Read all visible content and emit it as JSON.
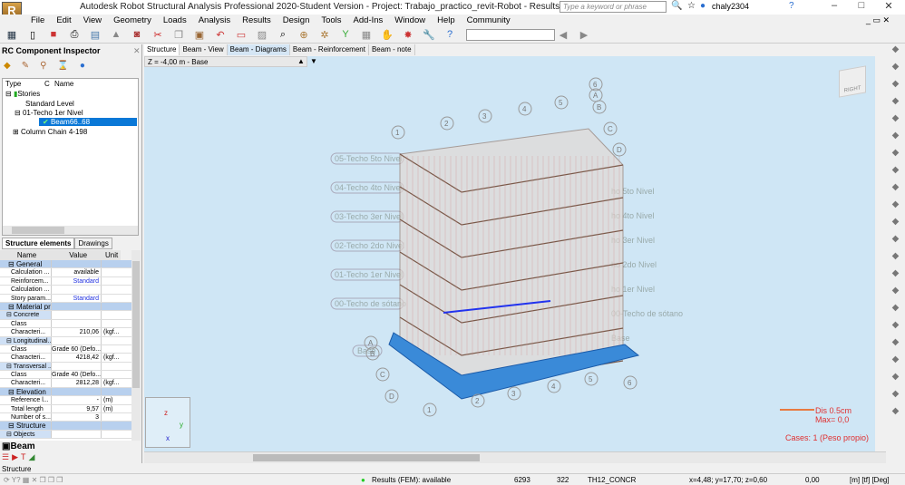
{
  "app": {
    "title": "Autodesk Robot Structural Analysis Professional 2020-Student Version - Project: Trabajo_practico_revit-Robot - Results (FEM): available",
    "logo": "R PRO",
    "search_placeholder": "Type a keyword or phrase",
    "user": "chaly2304"
  },
  "menu": [
    "File",
    "Edit",
    "View",
    "Geometry",
    "Loads",
    "Analysis",
    "Results",
    "Design",
    "Tools",
    "Add-Ins",
    "Window",
    "Help",
    "Community"
  ],
  "inspector": {
    "title": "RC Component Inspector",
    "tree_headers": [
      "Type",
      "C",
      "Name"
    ],
    "tree": [
      "Stories",
      "Standard Level",
      "01-Techo 1er Nivel",
      "Beam66..68",
      "Column Chain 4-198"
    ],
    "tabs": [
      "Structure elements",
      "Drawings"
    ],
    "prop_headers": [
      "Name",
      "Value",
      "Unit"
    ],
    "rows": [
      {
        "t": "grp",
        "n": "General"
      },
      {
        "n": "Calculation ...",
        "v": "available",
        "u": ""
      },
      {
        "n": "Reinforcem...",
        "v": "Standard",
        "u": "",
        "blue": true
      },
      {
        "n": "Calculation ...",
        "v": "",
        "u": ""
      },
      {
        "n": "Story param...",
        "v": "Standard",
        "u": "",
        "blue": true
      },
      {
        "t": "grp",
        "n": "Material properties"
      },
      {
        "t": "sub",
        "n": "Concrete"
      },
      {
        "n": "Class",
        "v": "",
        "u": ""
      },
      {
        "n": "Characteri...",
        "v": "210,06",
        "u": "(kgf..."
      },
      {
        "t": "sub",
        "n": "Longitudinal..."
      },
      {
        "n": "Class",
        "v": "Grade 60 (Defo...",
        "u": ""
      },
      {
        "n": "Characteri...",
        "v": "4218,42",
        "u": "(kgf..."
      },
      {
        "t": "sub",
        "n": "Transversal ..."
      },
      {
        "n": "Class",
        "v": "Grade 40 (Defo...",
        "u": ""
      },
      {
        "n": "Characteri...",
        "v": "2812,28",
        "u": "(kgf..."
      },
      {
        "t": "grp",
        "n": "Elevation"
      },
      {
        "n": "Reference l...",
        "v": "-",
        "u": "(m)"
      },
      {
        "n": "Total length",
        "v": "9,57",
        "u": "(m)"
      },
      {
        "n": "Number of s...",
        "v": "3",
        "u": ""
      },
      {
        "t": "grp",
        "n": "Structure"
      },
      {
        "t": "sub",
        "n": "Objects"
      }
    ],
    "bottom_tab": "Beam",
    "panel_label": "Structure"
  },
  "view": {
    "tabs": [
      "Structure",
      "Beam - View",
      "Beam - Diagrams",
      "Beam - Reinforcement",
      "Beam - note"
    ],
    "active_tab": 1,
    "z_label": "Z = -4,00 m - Base",
    "cube": "RIGHT",
    "stories_left": [
      "05-Techo 5to Nivel",
      "04-Techo 4to Nivel",
      "03-Techo 3er Nivel",
      "02-Techo 2do Nivel",
      "01-Techo 1er Nivel",
      "00-Techo de sótano",
      "Base"
    ],
    "stories_right": [
      "ho 5to Nivel",
      "ho 4to Nivel",
      "ho 3er Nivel",
      "ho 2do Nivel",
      "ho 1er Nivel",
      "00-Techo de sótano",
      "Base"
    ],
    "grid_numbers": [
      "1",
      "2",
      "3",
      "4",
      "5",
      "6"
    ],
    "grid_letters": [
      "A",
      "B",
      "C",
      "D"
    ],
    "legend_dis": "Dis  0.5cm",
    "legend_max": "Max=    0,0",
    "cases": "Cases: 1 (Peso propio)"
  },
  "status": {
    "fem": "Results (FEM): available",
    "nodes": "6293",
    "bars": "322",
    "section": "TH12_CONCR",
    "coords": "x=4,48; y=17,70; z=0,60",
    "angle": "0,00",
    "units": "[m] [tf] [Deg]"
  }
}
